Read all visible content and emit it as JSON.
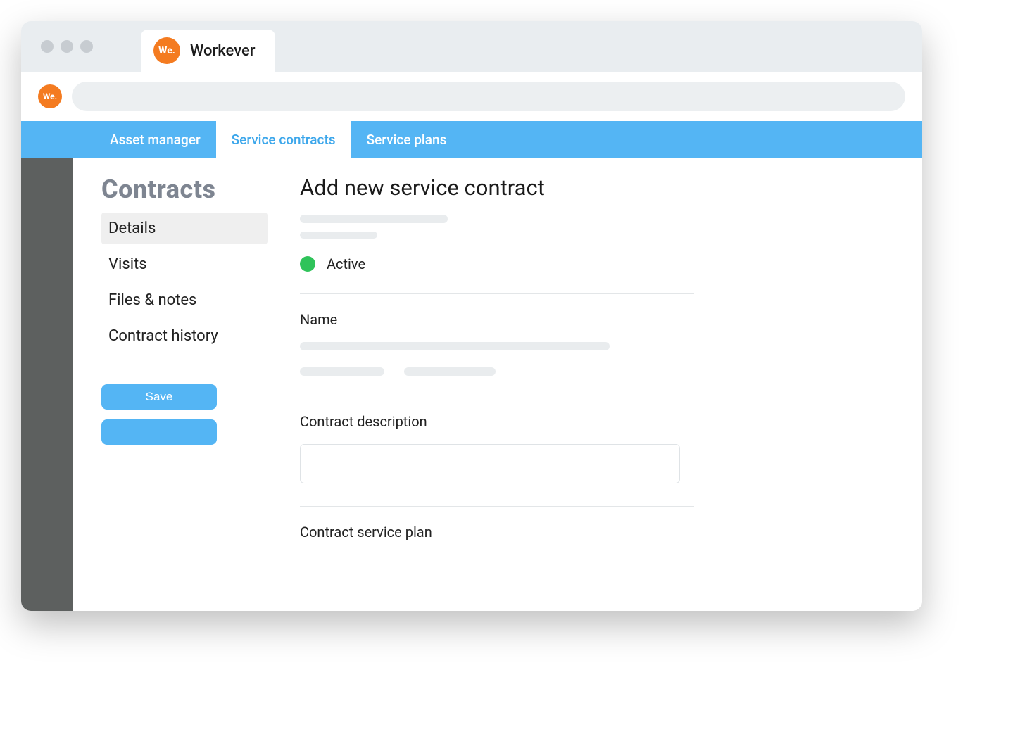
{
  "browser": {
    "tab_title": "Workever",
    "logo_text": "We.",
    "search_value": ""
  },
  "tabs": {
    "items": [
      {
        "label": "Asset manager",
        "active": false
      },
      {
        "label": "Service contracts",
        "active": true
      },
      {
        "label": "Service plans",
        "active": false
      }
    ]
  },
  "sidebar": {
    "heading": "Contracts",
    "items": [
      {
        "label": "Details",
        "active": true
      },
      {
        "label": "Visits",
        "active": false
      },
      {
        "label": "Files &  notes",
        "active": false
      },
      {
        "label": "Contract history",
        "active": false
      }
    ],
    "buttons": {
      "save": "Save",
      "secondary": ""
    }
  },
  "form": {
    "title": "Add new service contract",
    "status_label": "Active",
    "status_color": "#2fc35a",
    "name_label": "Name",
    "name_value": "",
    "description_label": "Contract description",
    "description_value": "",
    "service_plan_label": "Contract service plan"
  }
}
